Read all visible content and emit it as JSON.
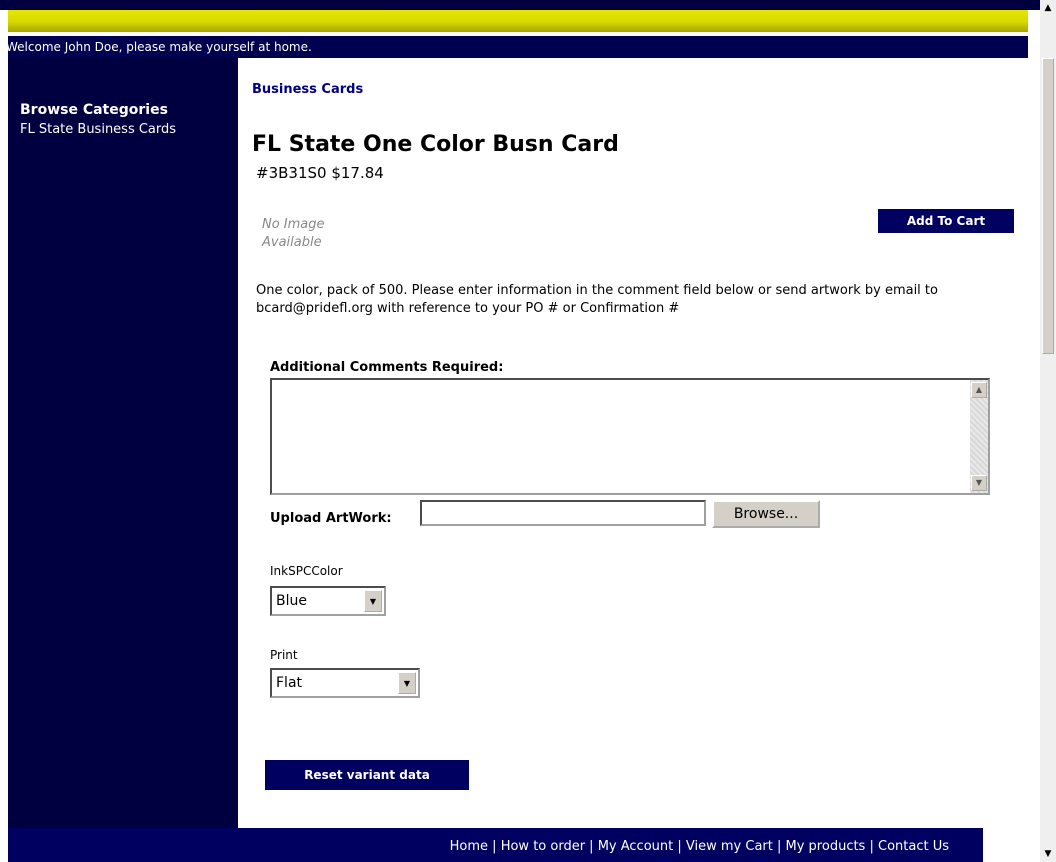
{
  "header": {
    "welcome_text": "Welcome John Doe, please make yourself at home."
  },
  "sidebar": {
    "title": "Browse Categories",
    "items": [
      {
        "label": "FL State Business Cards"
      }
    ]
  },
  "breadcrumb": "Business Cards",
  "product": {
    "title": "FL State One Color Busn Card",
    "meta": "#3B31S0 $17.84",
    "no_image_text": "No Image Available",
    "description": "One color, pack of 500. Please enter information in the comment field below or send artwork by email to bcard@pridefl.org  with reference to your PO # or Confirmation #"
  },
  "actions": {
    "add_to_cart_label": "Add To Cart",
    "reset_label": "Reset variant data"
  },
  "form": {
    "comments_label": "Additional Comments Required:",
    "comments_value": "",
    "upload_label": "Upload ArtWork:",
    "upload_value": "",
    "browse_label": "Browse...",
    "ink_label": "InkSPCColor",
    "ink_value": "Blue",
    "print_label": "Print",
    "print_value": "Flat"
  },
  "footer": {
    "links": [
      {
        "label": "Home"
      },
      {
        "label": "How to order"
      },
      {
        "label": "My Account"
      },
      {
        "label": "View my Cart"
      },
      {
        "label": "My products"
      },
      {
        "label": "Contact Us"
      }
    ],
    "separator": " | "
  },
  "icons": {
    "scroll_up": "up-arrow-icon",
    "scroll_down": "down-arrow-icon",
    "select_dropdown": "chevron-down-icon"
  }
}
